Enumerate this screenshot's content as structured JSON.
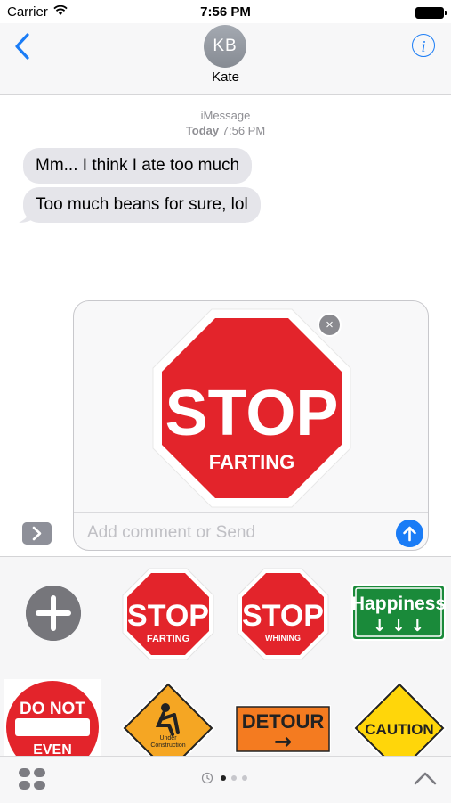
{
  "status_bar": {
    "carrier": "Carrier",
    "time": "7:56 PM"
  },
  "header": {
    "avatar_initials": "KB",
    "contact_name": "Kate",
    "info_icon": "i"
  },
  "thread": {
    "service": "iMessage",
    "timestamp_day": "Today",
    "timestamp_time": "7:56 PM",
    "messages": [
      {
        "text": "Mm... I think I ate too much"
      },
      {
        "text": "Too much beans for sure, lol"
      }
    ]
  },
  "compose": {
    "placeholder": "Add comment or Send",
    "sticker": {
      "line1": "STOP",
      "line2": "FARTING"
    },
    "close_glyph": "×"
  },
  "drawer": {
    "stickers": [
      {
        "kind": "stop",
        "line1": "STOP",
        "line2": "FARTING"
      },
      {
        "kind": "stop",
        "line1": "STOP",
        "line2": "WHINING"
      },
      {
        "kind": "green",
        "line1": "Happiness",
        "arrows": "↓ ↓ ↓"
      },
      {
        "kind": "donot",
        "line1": "DO NOT",
        "line2": "EVEN"
      },
      {
        "kind": "construction",
        "line1": "Under",
        "line2": "Construction"
      },
      {
        "kind": "detour",
        "line1": "DETOUR",
        "arrow": "→"
      },
      {
        "kind": "caution",
        "line1": "CAUTION"
      }
    ],
    "page_count": 3,
    "active_page": 1
  },
  "colors": {
    "accent": "#1a7cf6",
    "stop_red": "#e3242b",
    "bubble_gray": "#e5e5ea"
  }
}
